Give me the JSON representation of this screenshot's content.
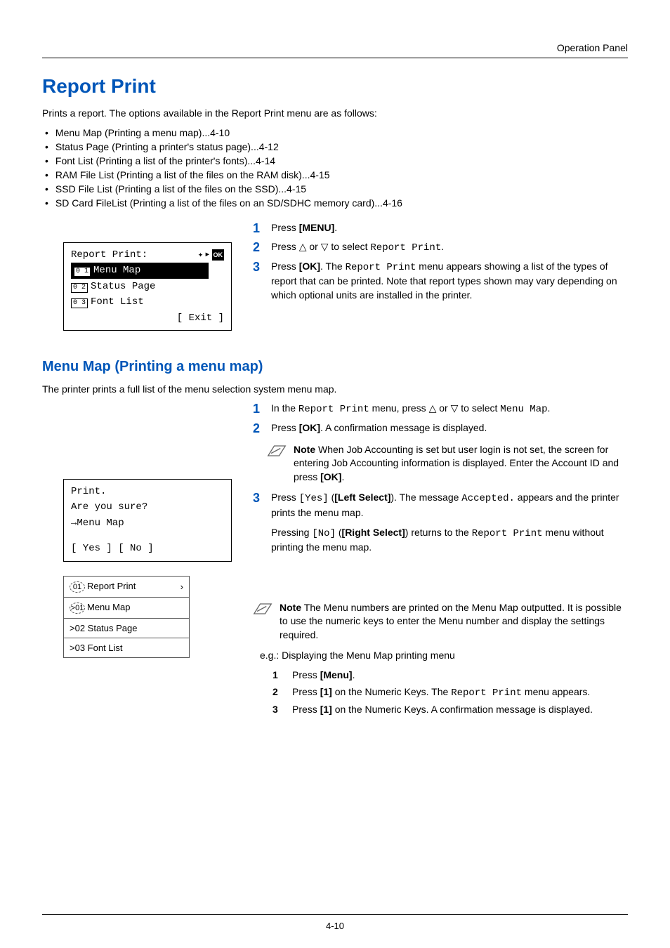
{
  "header": {
    "section": "Operation Panel"
  },
  "title": "Report Print",
  "intro": "Prints a report. The options available in the Report Print menu are as follows:",
  "bullets": [
    "Menu Map (Printing a menu map)...4-10",
    "Status Page (Printing a printer's status page)...4-12",
    "Font List (Printing a list of the printer's fonts)...4-14",
    "RAM File List (Printing a list of the files on the RAM disk)...4-15",
    "SSD File List (Printing a list of the files on the SSD)...4-15",
    "SD Card FileList (Printing a list of the files on an SD/SDHC memory card)...4-16"
  ],
  "lcd1": {
    "title": "Report Print:",
    "item1_num": "0 1",
    "item1": "Menu Map",
    "item2_num": "0 2",
    "item2": "Status Page",
    "item3_num": "0 3",
    "item3": "Font List",
    "exit": "[  Exit   ]"
  },
  "steps1": {
    "s1": {
      "n": "1",
      "a": "Press ",
      "b": "[MENU]",
      "c": "."
    },
    "s2": {
      "n": "2",
      "a": "Press ",
      "b1": "△",
      "mid": " or ",
      "b2": "▽",
      "c": " to select ",
      "m": "Report Print",
      "d": "."
    },
    "s3": {
      "n": "3",
      "a": "Press ",
      "b": "[OK]",
      "c": ". The ",
      "m": "Report Print",
      "d": " menu appears showing a list of the types of report that can be printed. Note that report types shown may vary depending on which optional units are installed in the printer."
    }
  },
  "subtitle": "Menu Map (Printing a menu map)",
  "subintro": "The printer prints a full list of the menu selection system menu map.",
  "lcd2": {
    "l1": "Print.",
    "l2": "Are you sure?",
    "l3": "→Menu Map",
    "l4": "[  Yes  ] [  No   ]"
  },
  "steps2": {
    "s1": {
      "n": "1",
      "a": "In the ",
      "m1": "Report Print",
      "b": " menu, press ",
      "u": "△",
      "mid": " or ",
      "d": "▽",
      "c": " to select ",
      "m2": "Menu Map",
      "e": "."
    },
    "s2": {
      "n": "2",
      "a": "Press ",
      "b": "[OK]",
      "c": ". A confirmation message is displayed."
    },
    "note1": {
      "label": "Note",
      "text": "  When Job Accounting is set but user login is not set, the screen for entering Job Accounting information is displayed. Enter the Account ID and press ",
      "b": "[OK]",
      "c": "."
    },
    "s3": {
      "n": "3",
      "a": "Press ",
      "m1": "[Yes]",
      "b": " (",
      "bb": "[Left Select]",
      "c": "). The message ",
      "m2": "Accepted.",
      "d": " appears and the printer prints the menu map."
    },
    "s3b": {
      "a": "Pressing ",
      "m1": "[No]",
      "b": " (",
      "bb": "[Right Select]",
      "c": ") returns to the ",
      "m2": "Report Print",
      "d": " menu without printing the menu map."
    }
  },
  "panel": {
    "r1_num": "01",
    "r1": "Report Print",
    "r2_num": ">01",
    "r2": "Menu Map",
    "r3": ">02 Status Page",
    "r4": ">03 Font List"
  },
  "note2": {
    "label": "Note",
    "text": "  The Menu numbers are printed on the Menu Map outputted. It is possible to use the numeric keys to enter the Menu number and display the settings required.",
    "eg": "e.g.: Displaying the Menu Map printing menu",
    "sub": {
      "s1": {
        "n": "1",
        "a": "Press ",
        "b": "[Menu]",
        "c": "."
      },
      "s2": {
        "n": "2",
        "a": "Press ",
        "b": "[1]",
        "c": " on the Numeric Keys. The ",
        "m": "Report Print",
        "d": " menu appears."
      },
      "s3": {
        "n": "3",
        "a": "Press ",
        "b": "[1]",
        "c": " on the Numeric Keys. A confirmation message is displayed."
      }
    }
  },
  "footer": "4-10"
}
